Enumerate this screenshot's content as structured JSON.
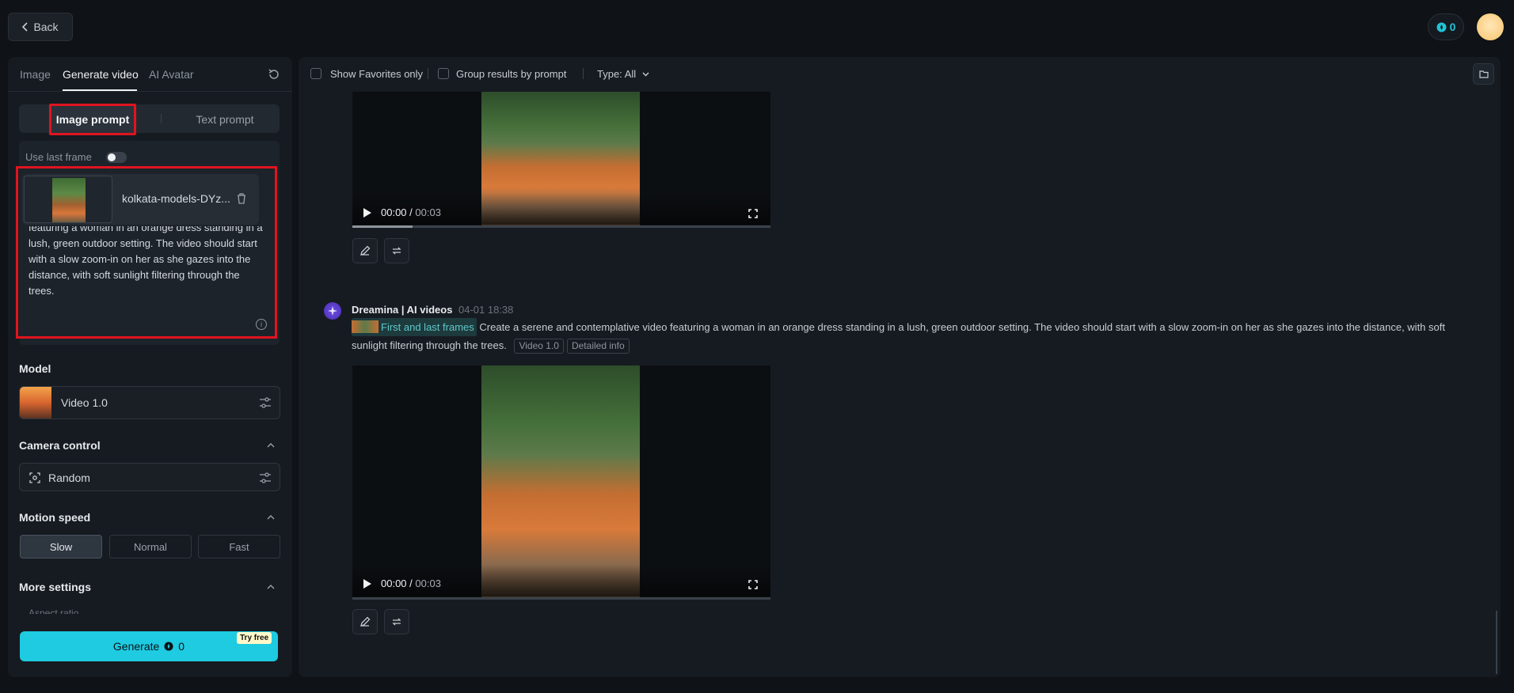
{
  "top_bar": {
    "back_label": "Back",
    "credits": "0"
  },
  "left_panel": {
    "tabs": [
      "Image",
      "Generate video",
      "AI Avatar"
    ],
    "mode_tabs": {
      "image": "Image prompt",
      "text": "Text prompt"
    },
    "use_last_frame_label": "Use last frame",
    "use_last_frame_on": false,
    "file_name": "kolkata-models-DYz...",
    "prompt_text": "featuring a woman in an orange dress standing in a lush, green outdoor setting. The video should start with a slow zoom-in on her as she gazes into the distance, with soft sunlight filtering through the trees.",
    "model_label": "Model",
    "model_name": "Video 1.0",
    "camera_label": "Camera control",
    "camera_value": "Random",
    "motion_label": "Motion speed",
    "speed_options": [
      "Slow",
      "Normal",
      "Fast"
    ],
    "speed_selected": "Slow",
    "more_settings_label": "More settings",
    "aspect_ratio_label": "Aspect ratio",
    "generate_label": "Generate",
    "generate_cost": "0",
    "try_free_label": "Try free"
  },
  "filters": {
    "favorites_label": "Show Favorites only",
    "group_label": "Group results by prompt",
    "type_label": "Type: All"
  },
  "results": [
    {
      "time_current": "00:00",
      "time_total": "00:03"
    },
    {
      "author": "Dreamina | AI videos",
      "timestamp": "04-01  18:38",
      "frames_tag": "First and last frames",
      "prompt": "Create a serene and contemplative video featuring a woman in an orange dress standing in a lush, green outdoor setting. The video should start with a slow zoom-in on her as she gazes into the distance, with soft sunlight filtering through the trees.",
      "model_tag": "Video 1.0",
      "info_tag": "Detailed info",
      "time_current": "00:00",
      "time_total": "00:03"
    }
  ],
  "colors": {
    "accent": "#1ecbe1",
    "highlight_frame": "#e0141f",
    "background": "#0f1216",
    "panel": "#161b21"
  },
  "icons": [
    "chevron-left-icon",
    "credit-icon",
    "refresh-icon",
    "trash-icon",
    "info-icon",
    "sliders-icon",
    "focus-icon",
    "chevron-up-icon",
    "folder-icon",
    "play-icon",
    "fullscreen-icon",
    "pencil-icon",
    "regenerate-icon",
    "dreamina-logo-icon",
    "chevron-down-icon"
  ]
}
